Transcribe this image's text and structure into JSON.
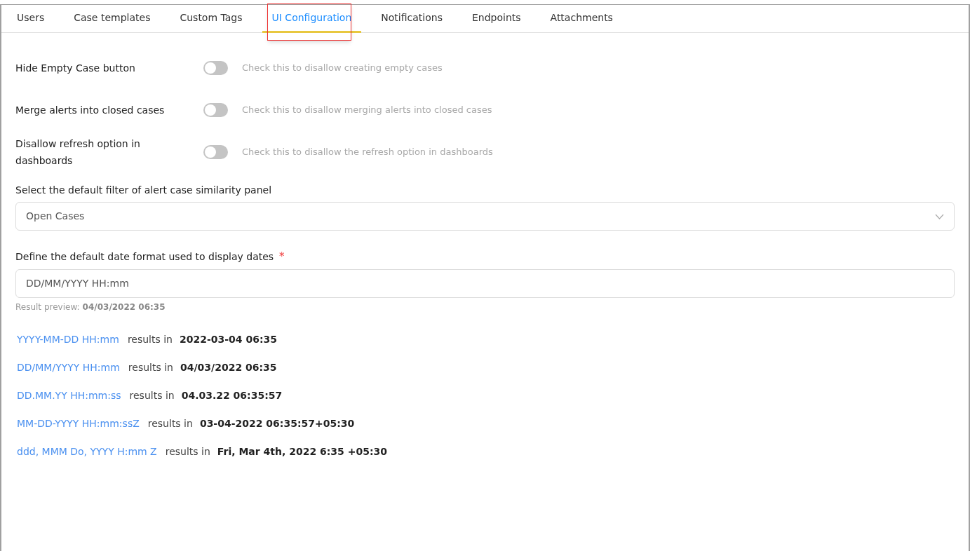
{
  "tabs": [
    {
      "label": "Users",
      "selected": false,
      "highlighted": false
    },
    {
      "label": "Case templates",
      "selected": false,
      "highlighted": false
    },
    {
      "label": "Custom Tags",
      "selected": false,
      "highlighted": false
    },
    {
      "label": "UI Configuration",
      "selected": true,
      "highlighted": true
    },
    {
      "label": "Notifications",
      "selected": false,
      "highlighted": false
    },
    {
      "label": "Endpoints",
      "selected": false,
      "highlighted": false
    },
    {
      "label": "Attachments",
      "selected": false,
      "highlighted": false
    }
  ],
  "settings": [
    {
      "label": "Hide Empty Case button",
      "on": false,
      "hint": "Check this to disallow creating empty cases"
    },
    {
      "label": "Merge alerts into closed cases",
      "on": false,
      "hint": "Check this to disallow merging alerts into closed cases"
    },
    {
      "label": "Disallow refresh option in dashboards",
      "on": false,
      "hint": "Check this to disallow the refresh option in dashboards"
    }
  ],
  "similarity_filter": {
    "label": "Select the default filter of alert case similarity panel",
    "value": "Open Cases"
  },
  "date_format": {
    "label": "Define the default date format used to display dates",
    "required_mark": "*",
    "value": "DD/MM/YYYY HH:mm",
    "preview_label": "Result preview:",
    "preview_value": "04/03/2022 06:35"
  },
  "examples": [
    {
      "format": "YYYY-MM-DD HH:mm",
      "connector": "results in",
      "result": "2022-03-04 06:35"
    },
    {
      "format": "DD/MM/YYYY HH:mm",
      "connector": "results in",
      "result": "04/03/2022 06:35"
    },
    {
      "format": "DD.MM.YY HH:mm:ss",
      "connector": "results in",
      "result": "04.03.22 06:35:57"
    },
    {
      "format": "MM-DD-YYYY HH:mm:ssZ",
      "connector": "results in",
      "result": "03-04-2022 06:35:57+05:30"
    },
    {
      "format": "ddd, MMM Do, YYYY H:mm Z",
      "connector": "results in",
      "result": "Fri, Mar 4th, 2022 6:35 +05:30"
    }
  ]
}
